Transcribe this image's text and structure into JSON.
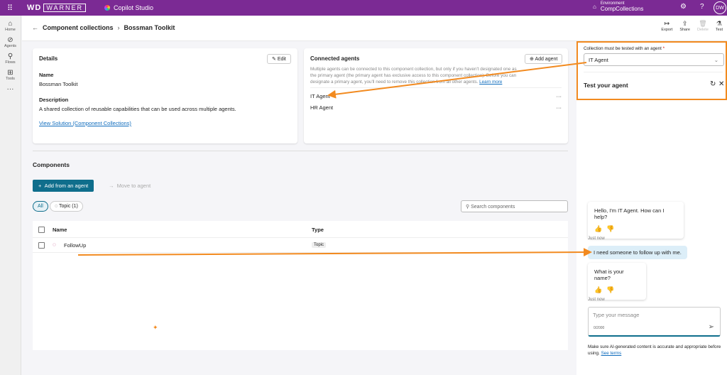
{
  "topbar": {
    "brand": "WD",
    "brand_sub": "WARNER",
    "app": "Copilot Studio",
    "env_label": "Environment",
    "env_name": "CompCollections",
    "avatar": "DW"
  },
  "rail": [
    {
      "icon": "⌂",
      "label": "Home"
    },
    {
      "icon": "⊘",
      "label": "Agents"
    },
    {
      "icon": "⚲",
      "label": "Flows"
    },
    {
      "icon": "⊞",
      "label": "Tools"
    },
    {
      "icon": "···",
      "label": ""
    }
  ],
  "breadcrumb": {
    "parent": "Component collections",
    "current": "Bossman Toolkit"
  },
  "toolbar": [
    {
      "icon": "↦",
      "label": "Export"
    },
    {
      "icon": "⇪",
      "label": "Share"
    },
    {
      "icon": "🗑",
      "label": "Delete"
    },
    {
      "icon": "⚗",
      "label": "Test"
    }
  ],
  "details": {
    "title": "Details",
    "edit": "Edit",
    "name_label": "Name",
    "name": "Bossman Toolkit",
    "desc_label": "Description",
    "desc": "A shared collection of reusable capabilities that can be used across multiple agents.",
    "link": "View Solution (Component Collections)"
  },
  "connected": {
    "title": "Connected agents",
    "add": "Add agent",
    "text": "Multiple agents can be connected to this component collection, but only if you haven't designated one as the primary agent (the primary agent has exclusive access to this component collection). Before you can designate a primary agent, you'll need to remove this collection from all other agents.",
    "learn": "Learn more",
    "agents": [
      "IT Agent",
      "HR Agent"
    ]
  },
  "components": {
    "title": "Components",
    "add": "Add from an agent",
    "move": "Move to agent",
    "filters": [
      "All",
      "Topic (1)"
    ],
    "search_placeholder": "Search components",
    "columns": [
      "Name",
      "Type"
    ],
    "rows": [
      {
        "name": "FollowUp",
        "type": "Topic"
      }
    ]
  },
  "test": {
    "select_label": "Collection must be tested with an agent",
    "required": "*",
    "selected": "IT Agent",
    "title": "Test your agent",
    "messages": [
      {
        "from": "bot",
        "text": "Hello, I'm IT Agent. How can I help?",
        "time": "Just now"
      },
      {
        "from": "user",
        "text": "I need someone to follow up with me."
      },
      {
        "from": "bot",
        "text": "What is your name?",
        "time": "Just now"
      }
    ],
    "placeholder": "Type your message",
    "counter": "0/2000",
    "disclaimer": "Make sure AI-generated content is accurate and appropriate before using.",
    "terms": "See terms"
  },
  "colors": {
    "topbar": "#7b2a94",
    "primary": "#0f6e8c",
    "annotation": "#f28a1f"
  }
}
